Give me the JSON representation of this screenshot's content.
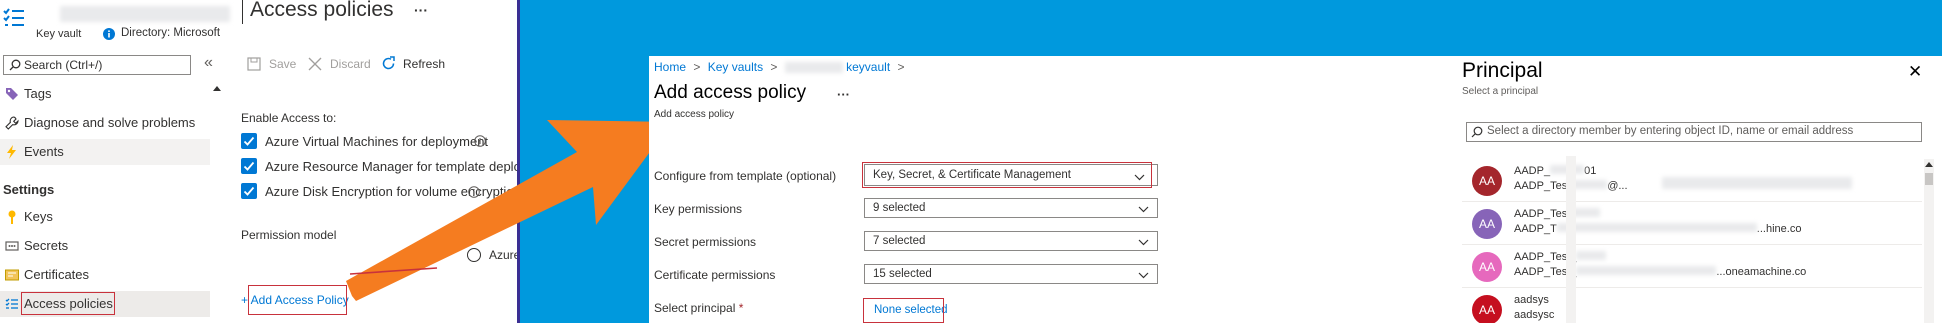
{
  "left_panel": {
    "header": {
      "subtitle": "Key vault",
      "directory": "Directory: Microsoft",
      "title": "Access policies",
      "ellipsis": "···"
    },
    "search": {
      "placeholder": "Search (Ctrl+/)",
      "collapse": "«"
    },
    "nav": {
      "tags": "Tags",
      "diagnose": "Diagnose and solve problems",
      "events": "Events",
      "settings_heading": "Settings",
      "keys": "Keys",
      "secrets": "Secrets",
      "certificates": "Certificates",
      "access_policies": "Access policies"
    },
    "toolbar": {
      "save": "Save",
      "discard": "Discard",
      "refresh": "Refresh"
    },
    "enable_access": {
      "heading": "Enable Access to:",
      "options": [
        "Azure Virtual Machines for deployment",
        "Azure Resource Manager for template deployment",
        "Azure Disk Encryption for volume encryption"
      ]
    },
    "permission_model": {
      "label": "Permission model",
      "option": "Azure"
    },
    "add_policy_link": "+ Add Access Policy"
  },
  "middle_panel": {
    "breadcrumb": {
      "home": "Home",
      "key_vaults": "Key vaults",
      "vault": "keyvault",
      "sep": ">"
    },
    "title": "Add access policy",
    "ellipsis": "···",
    "subtitle": "Add access policy",
    "fields": {
      "template": {
        "label": "Configure from template (optional)",
        "value": "Key, Secret, & Certificate Management"
      },
      "key": {
        "label": "Key permissions",
        "value": "9 selected"
      },
      "secret": {
        "label": "Secret permissions",
        "value": "7 selected"
      },
      "certificate": {
        "label": "Certificate permissions",
        "value": "15 selected"
      },
      "principal": {
        "label": "Select principal",
        "required": "*",
        "value": "None selected"
      }
    }
  },
  "right_panel": {
    "title": "Principal",
    "subtitle": "Select a principal",
    "close": "✕",
    "search_placeholder": "Select a directory member by entering object ID, name or email address",
    "items": [
      {
        "initials": "AA",
        "line1": "AADP_",
        "line1_tail": "01",
        "line2": "AADP_Tes",
        "line2_tail": "@...",
        "color": "#a4262c"
      },
      {
        "initials": "AA",
        "line1": "AADP_Test",
        "line2": "AADP_T",
        "line2_tail": "...hine.co",
        "color": "#8764b8"
      },
      {
        "initials": "AA",
        "line1": "AADP_Test_",
        "line2": "AADP_Test_",
        "line2_tail": "...oneamachine.co",
        "color": "#e669bd"
      },
      {
        "initials": "AA",
        "line1": "aadsys",
        "line2": "aadsysc",
        "color": "#c50f1f"
      }
    ]
  },
  "colors": {
    "background": "#0099dd",
    "arrow": "#f57c20",
    "accent": "#0078d4",
    "highlight_border": "#c8323c"
  }
}
